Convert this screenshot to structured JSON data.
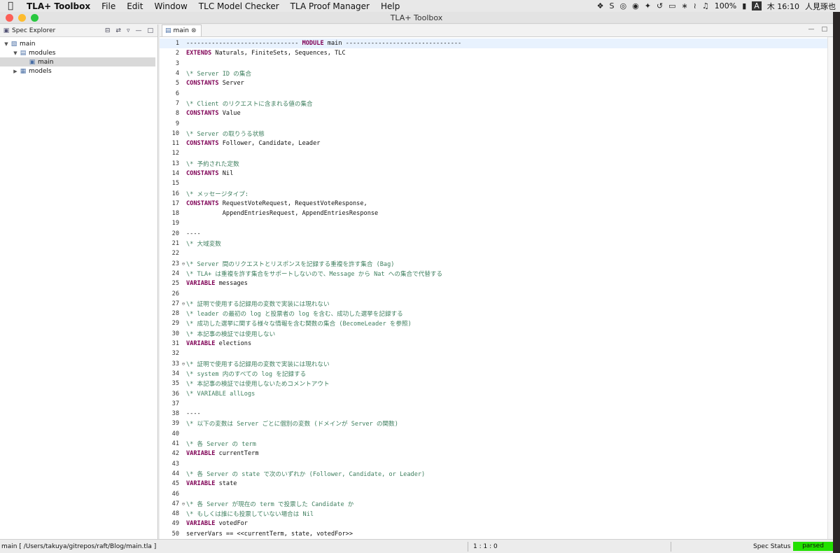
{
  "menubar": {
    "app_name": "TLA+ Toolbox",
    "items": [
      "File",
      "Edit",
      "Window",
      "TLC Model Checker",
      "TLA Proof Manager",
      "Help"
    ],
    "battery": "100%",
    "input_method": "A",
    "clock": "木 16:10",
    "user": "人見琢也"
  },
  "window": {
    "title": "TLA+ Toolbox"
  },
  "spec_explorer": {
    "title": "Spec Explorer",
    "tree": [
      {
        "label": "main",
        "depth": 0,
        "expanded": true,
        "icon": "folder-icon"
      },
      {
        "label": "modules",
        "depth": 1,
        "expanded": true,
        "icon": "modules-icon"
      },
      {
        "label": "main",
        "depth": 2,
        "selected": true,
        "icon": "module-file-icon"
      },
      {
        "label": "models",
        "depth": 1,
        "expanded": false,
        "icon": "models-icon"
      }
    ]
  },
  "editor": {
    "tab_label": "main",
    "lines": [
      {
        "n": "1",
        "t": "------------------------------- MODULE main --------------------------------",
        "k": "module",
        "cur": true
      },
      {
        "n": "2",
        "t": "EXTENDS Naturals, FiniteSets, Sequences, TLC",
        "k": "kw",
        "kw": "EXTENDS"
      },
      {
        "n": "3",
        "t": "",
        "k": "plain"
      },
      {
        "n": "4",
        "t": "\\* Server ID の集合",
        "k": "cm"
      },
      {
        "n": "5",
        "t": "CONSTANTS Server",
        "k": "kw",
        "kw": "CONSTANTS"
      },
      {
        "n": "6",
        "t": "",
        "k": "plain"
      },
      {
        "n": "7",
        "t": "\\* Client のリクエストに含まれる値の集合",
        "k": "cm"
      },
      {
        "n": "8",
        "t": "CONSTANTS Value",
        "k": "kw",
        "kw": "CONSTANTS"
      },
      {
        "n": "9",
        "t": "",
        "k": "plain"
      },
      {
        "n": "10",
        "t": "\\* Server の取りうる状態",
        "k": "cm"
      },
      {
        "n": "11",
        "t": "CONSTANTS Follower, Candidate, Leader",
        "k": "kw",
        "kw": "CONSTANTS"
      },
      {
        "n": "12",
        "t": "",
        "k": "plain"
      },
      {
        "n": "13",
        "t": "\\* 予約された定数",
        "k": "cm"
      },
      {
        "n": "14",
        "t": "CONSTANTS Nil",
        "k": "kw",
        "kw": "CONSTANTS"
      },
      {
        "n": "15",
        "t": "",
        "k": "plain"
      },
      {
        "n": "16",
        "t": "\\* メッセージタイプ:",
        "k": "cm"
      },
      {
        "n": "17",
        "t": "CONSTANTS RequestVoteRequest, RequestVoteResponse,",
        "k": "kw",
        "kw": "CONSTANTS"
      },
      {
        "n": "18",
        "t": "          AppendEntriesRequest, AppendEntriesResponse",
        "k": "plain"
      },
      {
        "n": "19",
        "t": "",
        "k": "plain"
      },
      {
        "n": "20",
        "t": "----",
        "k": "plain"
      },
      {
        "n": "21",
        "t": "\\* 大域変数",
        "k": "cm"
      },
      {
        "n": "22",
        "t": "",
        "k": "plain"
      },
      {
        "n": "23",
        "t": "\\* Server 間のリクエストとリスポンスを記録する重複を許す集合 (Bag)",
        "k": "cm",
        "fold": true
      },
      {
        "n": "24",
        "t": "\\* TLA+ は重複を許す集合をサポートしないので、Message から Nat への集合で代替する",
        "k": "cm"
      },
      {
        "n": "25",
        "t": "VARIABLE messages",
        "k": "kw",
        "kw": "VARIABLE"
      },
      {
        "n": "26",
        "t": "",
        "k": "plain"
      },
      {
        "n": "27",
        "t": "\\* 証明で使用する記録用の変数で実装には現れない",
        "k": "cm",
        "fold": true
      },
      {
        "n": "28",
        "t": "\\* leader の最初の log と投票者の log を含む、成功した選挙を記録する",
        "k": "cm"
      },
      {
        "n": "29",
        "t": "\\* 成功した選挙に関する様々な情報を含む関数の集合 (BecomeLeader を参照)",
        "k": "cm"
      },
      {
        "n": "30",
        "t": "\\* 本記事の検証では使用しない",
        "k": "cm"
      },
      {
        "n": "31",
        "t": "VARIABLE elections",
        "k": "kw",
        "kw": "VARIABLE"
      },
      {
        "n": "32",
        "t": "",
        "k": "plain"
      },
      {
        "n": "33",
        "t": "\\* 証明で使用する記録用の変数で実装には現れない",
        "k": "cm",
        "fold": true
      },
      {
        "n": "34",
        "t": "\\* system 内のすべての log を記録する",
        "k": "cm"
      },
      {
        "n": "35",
        "t": "\\* 本記事の検証では使用しないためコメントアウト",
        "k": "cm"
      },
      {
        "n": "36",
        "t": "\\* VARIABLE allLogs",
        "k": "cm"
      },
      {
        "n": "37",
        "t": "",
        "k": "plain"
      },
      {
        "n": "38",
        "t": "----",
        "k": "plain"
      },
      {
        "n": "39",
        "t": "\\* 以下の変数は Server ごとに個別の変数 (ドメインが Server の関数)",
        "k": "cm"
      },
      {
        "n": "40",
        "t": "",
        "k": "plain"
      },
      {
        "n": "41",
        "t": "\\* 各 Server の term",
        "k": "cm"
      },
      {
        "n": "42",
        "t": "VARIABLE currentTerm",
        "k": "kw",
        "kw": "VARIABLE"
      },
      {
        "n": "43",
        "t": "",
        "k": "plain"
      },
      {
        "n": "44",
        "t": "\\* 各 Server の state で次のいずれか (Follower, Candidate, or Leader)",
        "k": "cm"
      },
      {
        "n": "45",
        "t": "VARIABLE state",
        "k": "kw",
        "kw": "VARIABLE"
      },
      {
        "n": "46",
        "t": "",
        "k": "plain"
      },
      {
        "n": "47",
        "t": "\\* 各 Server が現在の term で投票した Candidate か",
        "k": "cm",
        "fold": true
      },
      {
        "n": "48",
        "t": "\\* もしくは誰にも投票していない場合は Nil",
        "k": "cm"
      },
      {
        "n": "49",
        "t": "VARIABLE votedFor",
        "k": "kw",
        "kw": "VARIABLE"
      },
      {
        "n": "50",
        "t": "serverVars == <<currentTerm, state, votedFor>>",
        "k": "plain"
      }
    ]
  },
  "statusbar": {
    "path": "main [ /Users/takuya/gitrepos/raft/Blog/main.tla ]",
    "cursor": "1 : 1 : 0",
    "spec_status_label": "Spec Status :",
    "spec_status_value": "parsed"
  }
}
